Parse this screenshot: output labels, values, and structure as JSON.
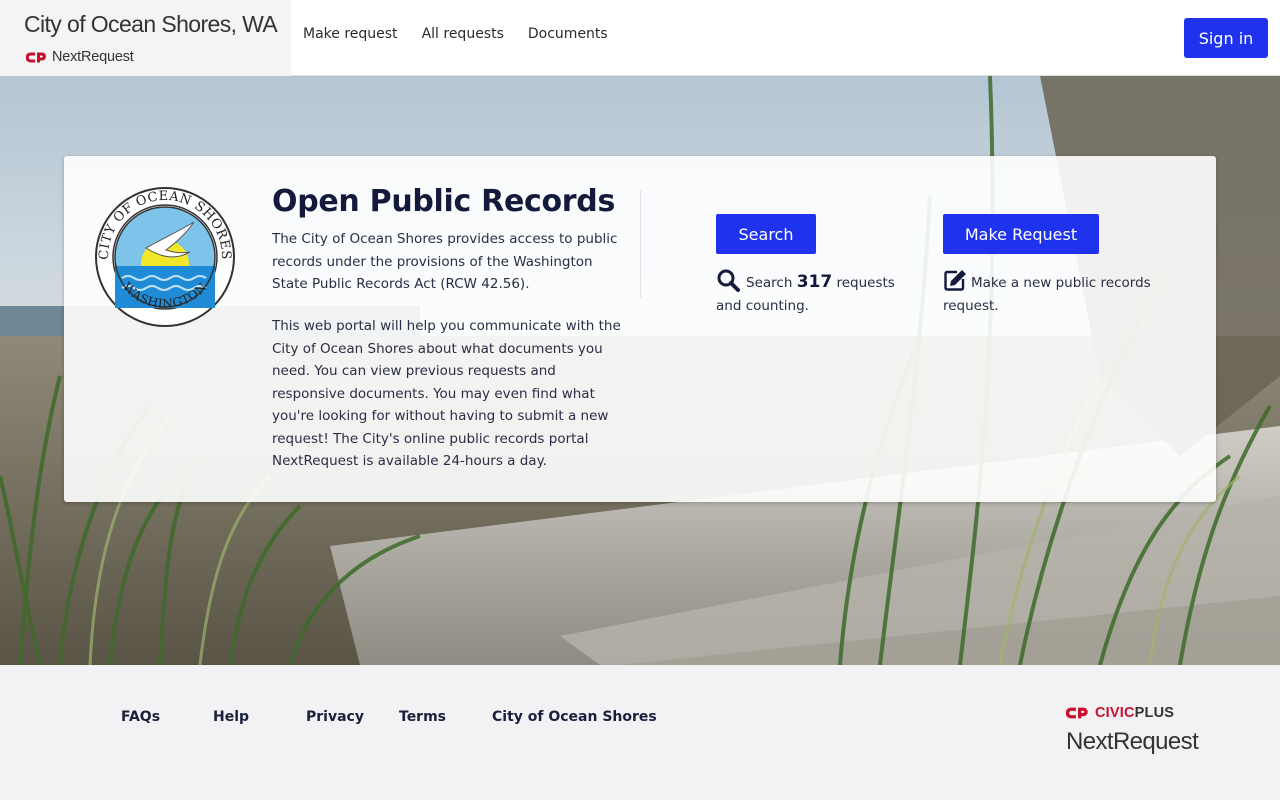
{
  "header": {
    "site_title": "City of Ocean Shores, WA",
    "brand_label": "NextRequest",
    "nav": [
      {
        "label": "Make request"
      },
      {
        "label": "All requests"
      },
      {
        "label": "Documents"
      }
    ],
    "signin_label": "Sign in"
  },
  "card": {
    "title": "Open Public Records",
    "paragraph1": "The City of Ocean Shores provides access to public records under the provisions of the Washington State Public Records Act (RCW 42.56).",
    "paragraph2": "This web portal will help you communicate with the City of Ocean Shores about what documents you need. You can view previous requests and responsive documents. You may even find what you're looking for without having to submit a new request! The City's online public records portal NextRequest is available 24-hours a day.",
    "seal": {
      "top_text": "CITY OF OCEAN SHORES",
      "bottom_text": "WASHINGTON"
    },
    "search": {
      "button_label": "Search",
      "text_before": "Search",
      "count": "317",
      "text_after": "requests and counting."
    },
    "make_request": {
      "button_label": "Make Request",
      "text": "Make a new public records request."
    }
  },
  "footer": {
    "links": [
      {
        "label": "FAQs"
      },
      {
        "label": "Help"
      },
      {
        "label": "Privacy"
      },
      {
        "label": "Terms"
      },
      {
        "label": "City of Ocean Shores"
      }
    ],
    "civic_word": "CIVIC",
    "plus_word": "PLUS",
    "product_word": "NextRequest"
  },
  "colors": {
    "primary_button": "#1f33ee",
    "brand_red": "#c8102e",
    "heading_navy": "#141a3c"
  }
}
